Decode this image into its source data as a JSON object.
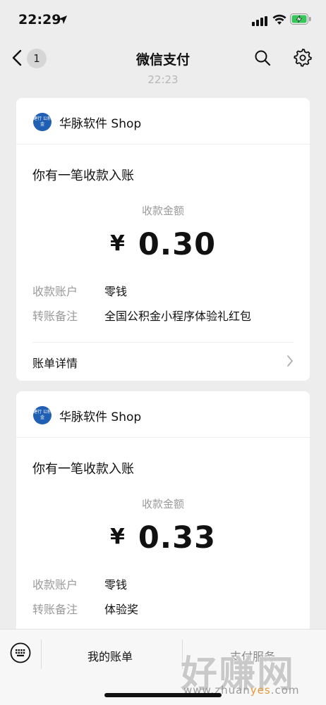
{
  "status_bar": {
    "time": "22:29"
  },
  "nav": {
    "badge_count": "1",
    "title": "微信支付"
  },
  "timestamp": "22:23",
  "cards": [
    {
      "merchant": "华脉软件 Shop",
      "logo_text": "建行 公积金",
      "title": "你有一笔收款入账",
      "amount_label": "收款金额",
      "currency": "¥",
      "amount": "0.30",
      "rows": [
        {
          "key": "收款账户",
          "value": "零钱"
        },
        {
          "key": "转账备注",
          "value": "全国公积金小程序体验礼红包"
        }
      ],
      "footer_label": "账单详情"
    },
    {
      "merchant": "华脉软件 Shop",
      "logo_text": "建行 公积金",
      "title": "你有一笔收款入账",
      "amount_label": "收款金额",
      "currency": "¥",
      "amount": "0.33",
      "rows": [
        {
          "key": "收款账户",
          "value": "零钱"
        },
        {
          "key": "转账备注",
          "value": "体验奖"
        }
      ]
    }
  ],
  "bottom_menu": {
    "items": [
      {
        "label": "我的账单"
      },
      {
        "label": "支付服务"
      }
    ]
  },
  "watermark": {
    "text": "好赚网",
    "url_prefix": "www.zhuan",
    "url_accent": "yes",
    "url_suffix": ".com"
  },
  "colors": {
    "background": "#ededed",
    "card": "#ffffff",
    "muted_text": "#9a9a9a",
    "battery_green": "#35c759",
    "logo_blue": "#1f5fb4"
  }
}
